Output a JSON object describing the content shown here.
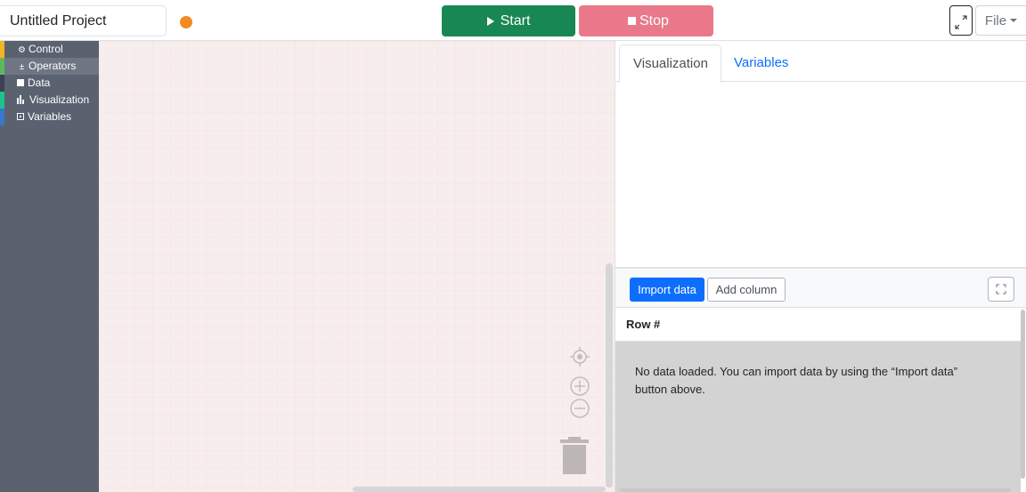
{
  "project": {
    "name": "Untitled Project",
    "status_color": "#f38b25"
  },
  "toolbar": {
    "start_label": "Start",
    "start_color": "#198754",
    "stop_label": "Stop",
    "stop_color": "#e9798a",
    "file_label": "File"
  },
  "toolbox": {
    "categories": [
      {
        "label": "Control",
        "icon": "gear-icon",
        "color": "#f3b425"
      },
      {
        "label": "Operators",
        "icon": "plus-minus-icon",
        "color": "#5cb85c"
      },
      {
        "label": "Data",
        "icon": "square-icon",
        "color": "#3d3f57"
      },
      {
        "label": "Visualization",
        "icon": "bar-chart-icon",
        "color": "#1bc48a"
      },
      {
        "label": "Variables",
        "icon": "box-icon",
        "color": "#3c77c9"
      }
    ]
  },
  "panel": {
    "tabs": [
      {
        "label": "Visualization"
      },
      {
        "label": "Variables"
      }
    ],
    "import_label": "Import data",
    "add_column_label": "Add column",
    "table_header": "Row #",
    "empty_message": "No data loaded. You can import data by using the “Import data” button above."
  }
}
